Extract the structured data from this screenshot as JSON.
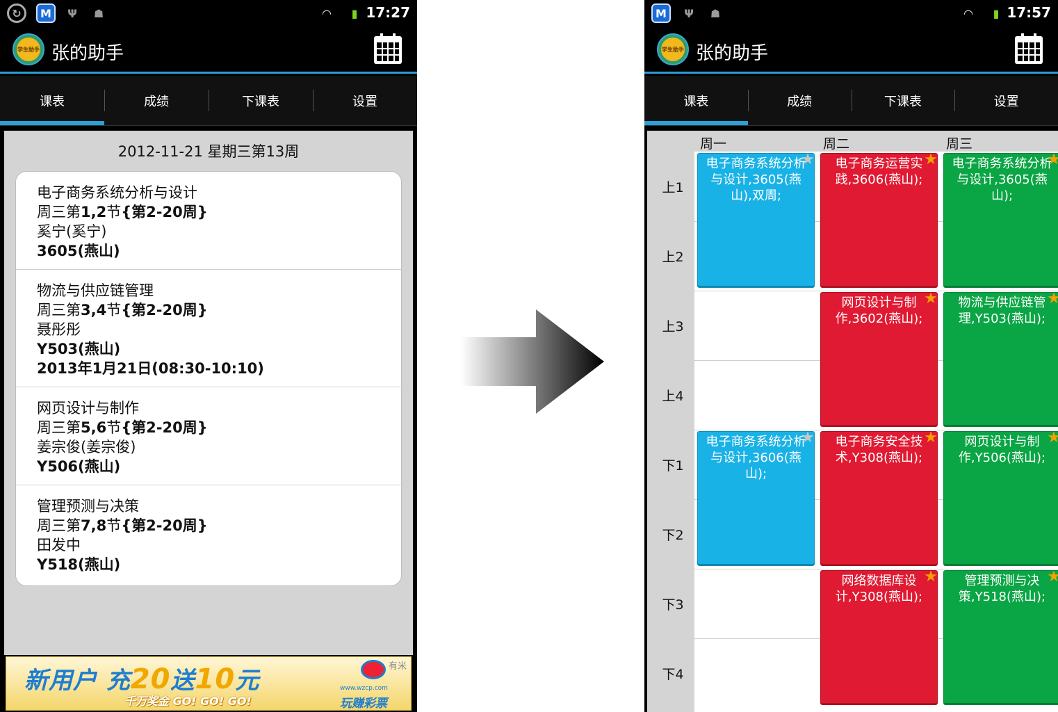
{
  "left_phone": {
    "status_time": "17:27",
    "app_title": "张的助手",
    "tabs": [
      {
        "label": "课表",
        "active": true
      },
      {
        "label": "成绩",
        "active": false
      },
      {
        "label": "下课表",
        "active": false
      },
      {
        "label": "设置",
        "active": false
      }
    ],
    "date_header": "2012-11-21 星期三第13周",
    "courses": [
      {
        "name": "电子商务系统分析与设计",
        "time_prefix": "周三第",
        "time_bold": "1,2",
        "time_mid": "节",
        "time_weeks": "{第2-20周}",
        "teacher": "奚宁(奚宁)",
        "room_bold": "3605",
        "room_rest": "(燕山)",
        "extra": ""
      },
      {
        "name": "物流与供应链管理",
        "time_prefix": "周三第",
        "time_bold": "3,4",
        "time_mid": "节",
        "time_weeks": "{第2-20周}",
        "teacher": "聂彤彤",
        "room_bold": "Y503",
        "room_rest": "(燕山)",
        "extra": "2013年1月21日(08:30-10:10)"
      },
      {
        "name": "网页设计与制作",
        "time_prefix": "周三第",
        "time_bold": "5,6",
        "time_mid": "节",
        "time_weeks": "{第2-20周}",
        "teacher": "姜宗俊(姜宗俊)",
        "room_bold": "Y506",
        "room_rest": "(燕山)",
        "extra": ""
      },
      {
        "name": "管理预测与决策",
        "time_prefix": "周三第",
        "time_bold": "7,8",
        "time_mid": "节",
        "time_weeks": "{第2-20周}",
        "teacher": "田发中",
        "room_bold": "Y518",
        "room_rest": "(燕山)",
        "extra": ""
      }
    ],
    "ad": {
      "main_a": "新用户 充",
      "main_b": "20",
      "main_c": "送",
      "main_d": "10",
      "main_e": "元",
      "sub": "千万奖金 GO! GO! GO!",
      "tag": "有米",
      "url": "www.wzcp.com",
      "brand": "玩赚彩票"
    }
  },
  "right_phone": {
    "status_time": "17:57",
    "app_title": "张的助手",
    "tabs": [
      {
        "label": "课表",
        "active": true
      },
      {
        "label": "成绩",
        "active": false
      },
      {
        "label": "下课表",
        "active": false
      },
      {
        "label": "设置",
        "active": false
      }
    ],
    "days": [
      "周一",
      "周二",
      "周三"
    ],
    "periods": [
      "上1",
      "上2",
      "上3",
      "上4",
      "下1",
      "下2",
      "下3",
      "下4"
    ],
    "cells": [
      {
        "day": 0,
        "start": 0,
        "span": 2,
        "color": "blue",
        "text": "电子商务系统分析与设计,3605(燕山),双周;"
      },
      {
        "day": 1,
        "start": 0,
        "span": 2,
        "color": "red",
        "text": "电子商务运营实践,3606(燕山);"
      },
      {
        "day": 2,
        "start": 0,
        "span": 2,
        "color": "green",
        "text": "电子商务系统分析与设计,3605(燕山);"
      },
      {
        "day": 1,
        "start": 2,
        "span": 2,
        "color": "red",
        "text": "网页设计与制作,3602(燕山);"
      },
      {
        "day": 2,
        "start": 2,
        "span": 2,
        "color": "green",
        "text": "物流与供应链管理,Y503(燕山);"
      },
      {
        "day": 0,
        "start": 4,
        "span": 2,
        "color": "blue",
        "text": "电子商务系统分析与设计,3606(燕山);"
      },
      {
        "day": 1,
        "start": 4,
        "span": 2,
        "color": "red",
        "text": "电子商务安全技术,Y308(燕山);"
      },
      {
        "day": 2,
        "start": 4,
        "span": 2,
        "color": "green",
        "text": "网页设计与制作,Y506(燕山);"
      },
      {
        "day": 1,
        "start": 6,
        "span": 2,
        "color": "red",
        "text": "网络数据库设计,Y308(燕山);"
      },
      {
        "day": 2,
        "start": 6,
        "span": 2,
        "color": "green",
        "text": "管理预测与决策,Y518(燕山);"
      }
    ]
  },
  "icons": {
    "logo_text": "学生助手",
    "star": "★"
  },
  "colors": {
    "accent": "#2a9fd8",
    "blue_cell": "#19b2e6",
    "red_cell": "#e01a32",
    "green_cell": "#0aa544"
  }
}
